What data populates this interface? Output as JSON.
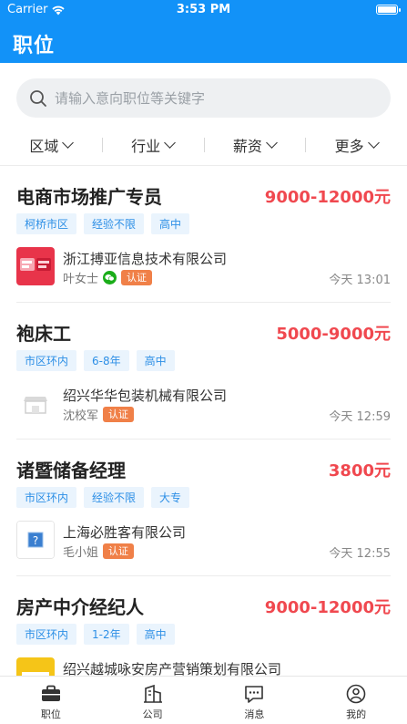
{
  "status_bar": {
    "carrier": "Carrier",
    "time": "3:53 PM"
  },
  "header": {
    "title": "职位"
  },
  "search": {
    "placeholder": "请输入意向职位等关键字"
  },
  "filters": [
    {
      "label": "区域"
    },
    {
      "label": "行业"
    },
    {
      "label": "薪资"
    },
    {
      "label": "更多"
    }
  ],
  "jobs": [
    {
      "title": "电商市场推广专员",
      "salary": "9000-12000元",
      "tags": [
        "柯桥市区",
        "经验不限",
        "高中"
      ],
      "company": "浙江搏亚信息技术有限公司",
      "contact": "叶女士",
      "verified": "认证",
      "posted": "今天 13:01",
      "logo_icon": "red-brand-logo-icon"
    },
    {
      "title": "袍床工",
      "salary": "5000-9000元",
      "tags": [
        "市区环内",
        "6-8年",
        "高中"
      ],
      "company": "绍兴华华包装机械有限公司",
      "contact": "沈校军",
      "verified": "认证",
      "posted": "今天 12:59",
      "logo_icon": "storefront-icon"
    },
    {
      "title": "诸暨储备经理",
      "salary": "3800元",
      "tags": [
        "市区环内",
        "经验不限",
        "大专"
      ],
      "company": "上海必胜客有限公司",
      "contact": "毛小姐",
      "verified": "认证",
      "posted": "今天 12:55",
      "logo_icon": "question-mark-icon"
    },
    {
      "title": "房产中介经纪人",
      "salary": "9000-12000元",
      "tags": [
        "市区环内",
        "1-2年",
        "高中"
      ],
      "company": "绍兴越城咏安房产营销策划有限公司",
      "contact": "",
      "verified": "",
      "posted": "",
      "logo_icon": "yellow-brand-logo-icon"
    }
  ],
  "tabbar": [
    {
      "label": "职位",
      "icon": "briefcase-icon",
      "active": true
    },
    {
      "label": "公司",
      "icon": "building-icon",
      "active": false
    },
    {
      "label": "消息",
      "icon": "message-icon",
      "active": false
    },
    {
      "label": "我的",
      "icon": "profile-icon",
      "active": false
    }
  ],
  "colors": {
    "brand": "#1292f8",
    "salary": "#f0484f",
    "tag_bg": "#eaf4fd",
    "tag_text": "#2d8fe6",
    "badge": "#f08048"
  }
}
